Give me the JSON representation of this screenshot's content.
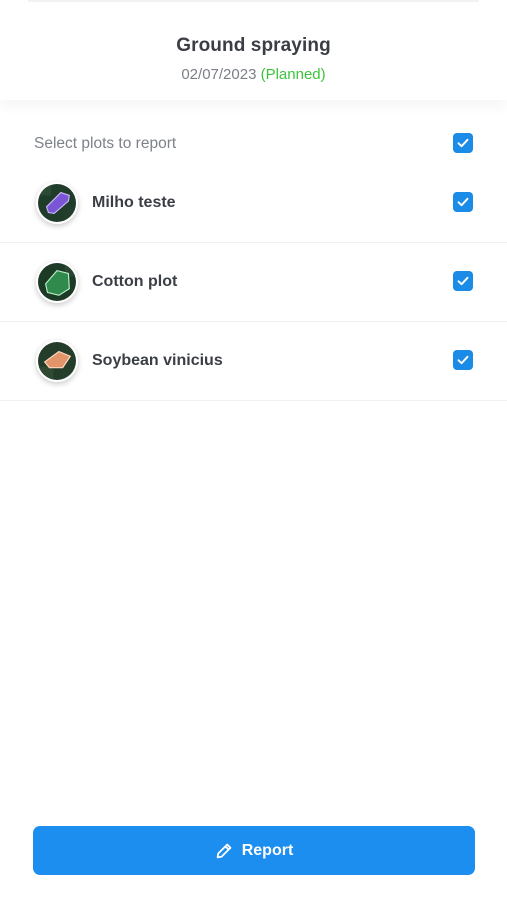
{
  "header": {
    "title": "Ground spraying",
    "date": "02/07/2023",
    "status": "(Planned)",
    "status_color": "#3cc43c"
  },
  "select_all": {
    "label": "Select plots to report",
    "checked": true
  },
  "plots": [
    {
      "name": "Milho teste",
      "checked": true,
      "thumbnail_icon": "plot-map-thumbnail-icon",
      "shape_color": "#7a56d6"
    },
    {
      "name": "Cotton plot",
      "checked": true,
      "thumbnail_icon": "plot-map-thumbnail-icon",
      "shape_color": "#3aa55c"
    },
    {
      "name": "Soybean vinicius",
      "checked": true,
      "thumbnail_icon": "plot-map-thumbnail-icon",
      "shape_color": "#e2956a"
    }
  ],
  "report_button": {
    "label": "Report",
    "icon": "pencil-icon",
    "color": "#1b8eef"
  },
  "checkbox_color": "#1b8be8"
}
